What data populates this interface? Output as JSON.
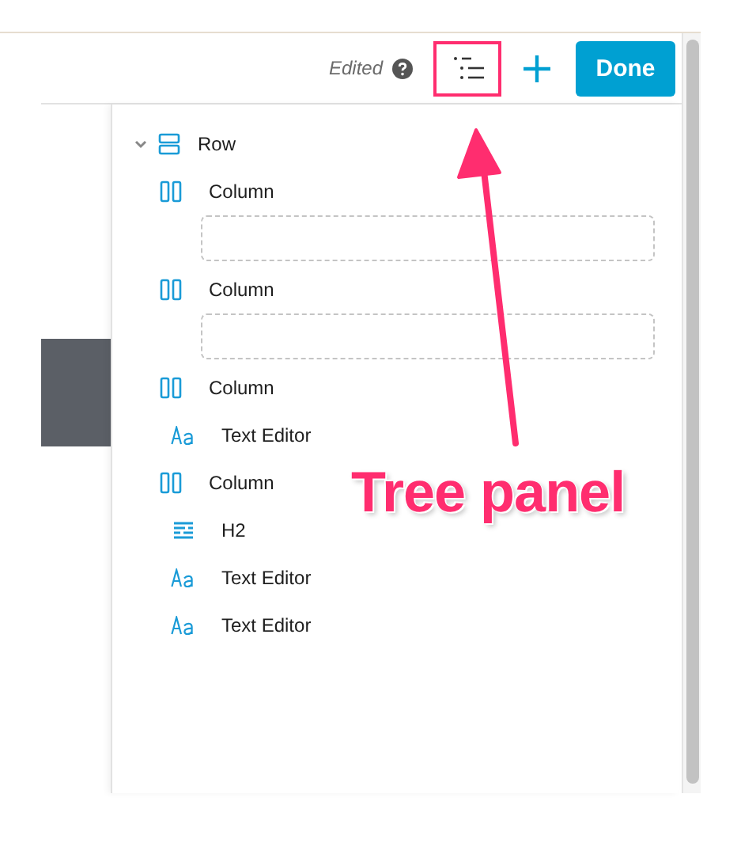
{
  "toolbar": {
    "status": "Edited",
    "done_button": "Done"
  },
  "tree": [
    {
      "label": "Row",
      "kind": "row",
      "expanded": true,
      "children": [
        {
          "label": "Column",
          "kind": "column",
          "empty": true
        },
        {
          "label": "Column",
          "kind": "column",
          "empty": true
        },
        {
          "label": "Column",
          "kind": "column",
          "empty": false,
          "children": [
            {
              "label": "Text Editor",
              "kind": "text"
            }
          ]
        },
        {
          "label": "Column",
          "kind": "column",
          "empty": false,
          "children": [
            {
              "label": "H2",
              "kind": "heading"
            },
            {
              "label": "Text Editor",
              "kind": "text"
            },
            {
              "label": "Text Editor",
              "kind": "text"
            }
          ]
        }
      ]
    }
  ],
  "annotation": {
    "label": "Tree panel"
  }
}
